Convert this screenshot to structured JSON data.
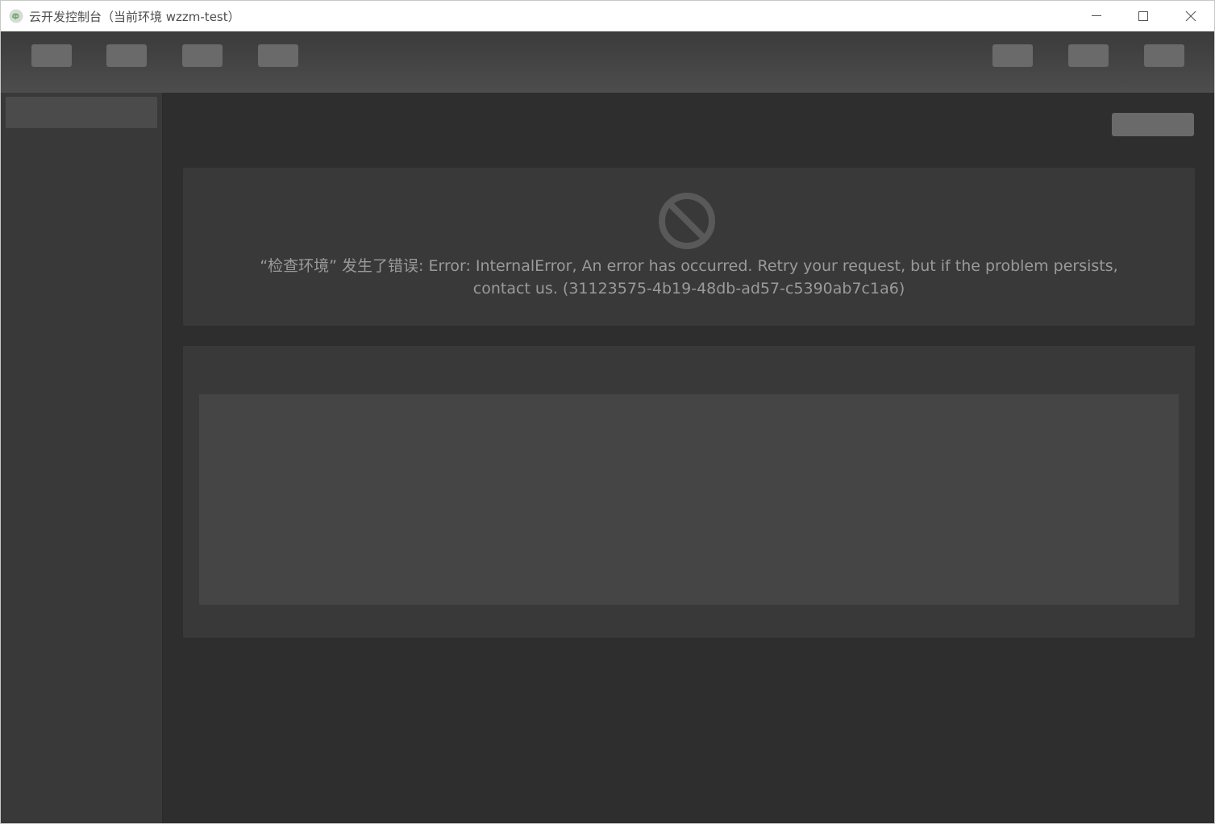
{
  "window": {
    "title": "云开发控制台（当前环境 wzzm-test）",
    "app_icon": "wechat-devtools-icon",
    "controls": [
      "minimize-icon",
      "maximize-icon",
      "close-icon"
    ]
  },
  "toolbar": {
    "left_buttons": [
      "",
      "",
      "",
      ""
    ],
    "right_buttons": [
      "",
      "",
      ""
    ]
  },
  "sidebar": {
    "items": [
      ""
    ]
  },
  "main": {
    "top_action_label": "",
    "error": {
      "icon": "prohibited-icon",
      "message": "“检查环境” 发生了错误: Error: InternalError, An error has occurred. Retry your request, but if the problem persists, contact us. (31123575-4b19-48db-ad57-c5390ab7c1a6)"
    }
  },
  "colors": {
    "titlebar": "#ffffff",
    "toolbar_top": "#3b3b3b",
    "toolbar_bottom": "#4d4d4d",
    "sidebar": "#393939",
    "main_bg": "#2e2e2e",
    "panel": "#393939",
    "placeholder_button": "#6a6a6a",
    "error_text": "#9a9a9a",
    "error_icon": "#595959"
  }
}
